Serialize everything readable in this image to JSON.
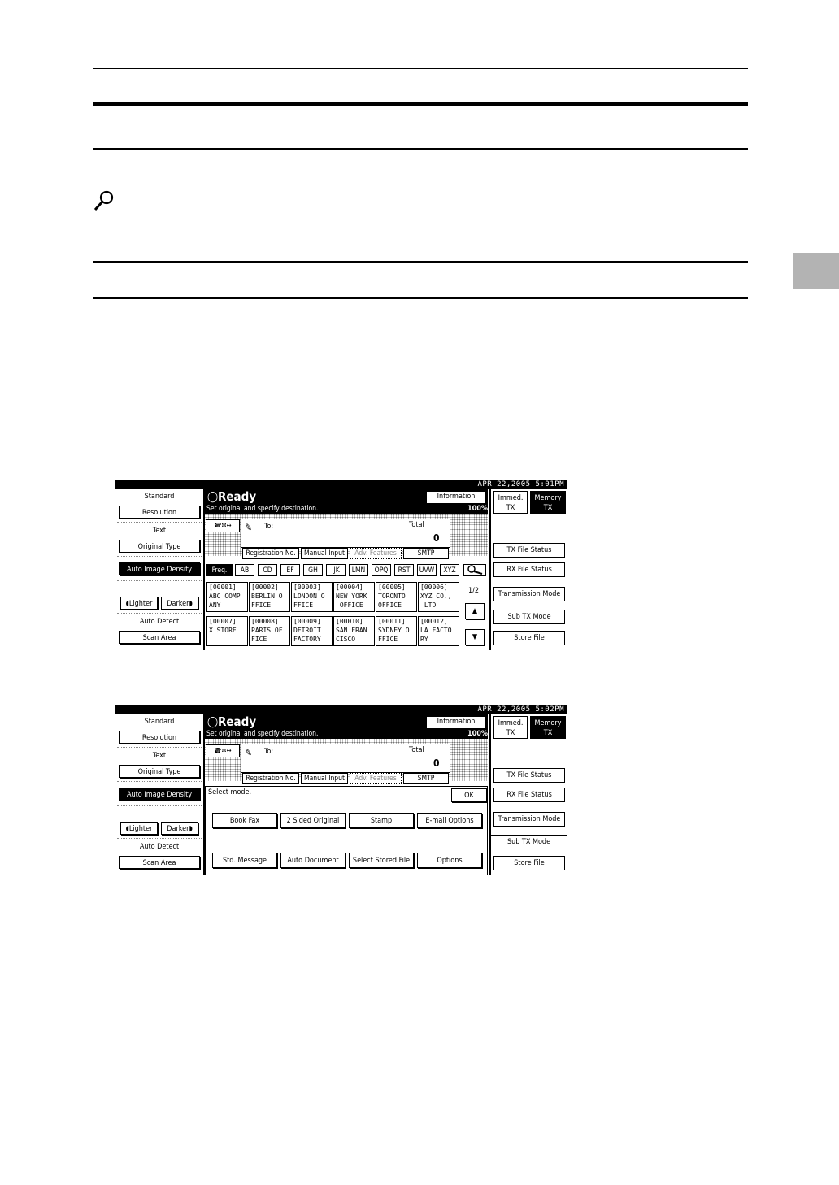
{
  "panels": [
    {
      "date": "APR  22,2005  5:01PM",
      "status": "Ready",
      "subtitle": "Set original and specify destination.",
      "percent": "100%",
      "left": {
        "standard": "Standard",
        "resolution": "Resolution",
        "text": "Text",
        "original_type": "Original Type",
        "auto_density": "Auto Image Density",
        "lighter": "Lighter",
        "darker": "Darker",
        "auto_detect": "Auto Detect",
        "scan_area": "Scan Area"
      },
      "info": "Information",
      "to_label": "To:",
      "total_label": "Total",
      "total_value": "0",
      "tabs": [
        "Registration No.",
        "Manual Input",
        "Adv. Features",
        "SMTP"
      ],
      "alpha": [
        "Freq.",
        "AB",
        "CD",
        "EF",
        "GH",
        "IJK",
        "LMN",
        "OPQ",
        "RST",
        "UVW",
        "XYZ"
      ],
      "page": "1/2",
      "cells": [
        "[00001]\nABC COMP\nANY",
        "[00002]\nBERLIN O\nFFICE",
        "[00003]\nLONDON O\nFFICE",
        "[00004]\nNEW YORK\n OFFICE",
        "[00005]\nTORONTO\nOFFICE",
        "[00006]\nXYZ CO.,\n LTD",
        "[00007]\nX STORE",
        "[00008]\nPARIS OF\nFICE",
        "[00009]\nDETROIT\nFACTORY",
        "[00010]\nSAN FRAN\nCISCO",
        "[00011]\nSYDNEY O\nFFICE",
        "[00012]\nLA FACTO\nRY"
      ],
      "right": {
        "immed": "Immed.\nTX",
        "memory": "Memory\nTX",
        "tx_status": "TX File Status",
        "rx_status": "RX File Status",
        "trans_mode": "Transmission Mode",
        "sub_tx": "Sub TX Mode",
        "store": "Store File"
      }
    },
    {
      "date": "APR  22,2005  5:02PM",
      "status": "Ready",
      "subtitle": "Set original and specify destination.",
      "percent": "100%",
      "select_mode": "Select mode.",
      "ok": "OK",
      "modes": [
        "Book Fax",
        "2 Sided Original",
        "Stamp",
        "E-mail Options",
        "Std. Message",
        "Auto Document",
        "Select Stored File",
        "Options"
      ]
    }
  ]
}
